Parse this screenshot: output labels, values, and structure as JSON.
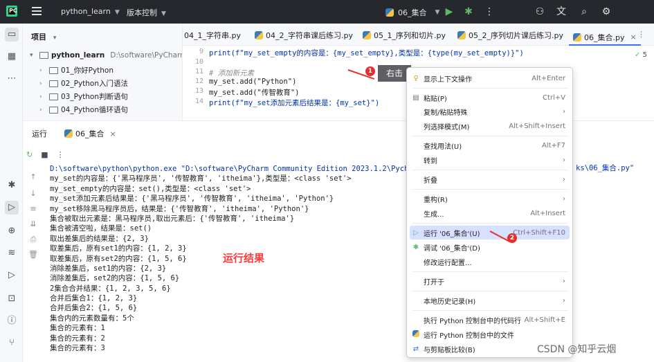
{
  "titlebar": {
    "logo_text": "PC",
    "project_name": "python_learn",
    "vcs_label": "版本控制",
    "run_config": "06_集合",
    "icons": [
      "play-icon",
      "debug-icon",
      "more-icon",
      "add-user-icon",
      "translate-icon",
      "search-icon",
      "settings-icon"
    ]
  },
  "project": {
    "header": "项目",
    "root_name": "python_learn",
    "root_path": "D:\\software\\PyCharm Co",
    "items": [
      "01_你好Python",
      "02_Python入门语法",
      "03_Python判断语句",
      "04_Python循环语句"
    ]
  },
  "tabs": [
    {
      "label": "04_1_字符串.py"
    },
    {
      "label": "04_2_字符串课后练习.py"
    },
    {
      "label": "05_1_序列和切片.py"
    },
    {
      "label": "05_2_序列切片课后练习.py"
    },
    {
      "label": "06_集合.py"
    }
  ],
  "editor": {
    "inspection_count": "5",
    "line_numbers": [
      "9",
      "10",
      "11",
      "12",
      "13",
      "14"
    ],
    "lines": [
      "print(f\"my_set_empty的内容是：{my_set_empty},类型是：{type(my_set_empty)}\")",
      "",
      "# 添加新元素",
      "my_set.add(\"Python\")",
      "my_set.add(\"传智教育\")",
      "print(f\"my_set添加元素后结果是：{my_set}\")"
    ]
  },
  "run_panel": {
    "title": "运行",
    "tab_label": "06_集合",
    "console": [
      "D:\\software\\python\\python.exe \"D:\\software\\PyCharm Community Edition 2023.1.2\\Pych",
      "my_set的内容是：{'黑马程序员', '传智教育', 'itheima'},类型是：<class 'set'>",
      "my_set_empty的内容是：set(),类型是：<class 'set'>",
      "my_set添加元素后结果是：{'黑马程序员', '传智教育', 'itheima', 'Python'}",
      "my_set移除黑马程序员后，结果是：{'传智教育', 'itheima', 'Python'}",
      "集合被取出元素是：黑马程序员,取出元素后：{'传智教育', 'itheima'}",
      "集合被清空啦，结果是：set()",
      "取出差集后的结果是：{2, 3}",
      "取差集后，原有set1的内容：{1, 2, 3}",
      "取差集后，原有set2的内容：{1, 5, 6}",
      "消除差集后，set1的内容：{2, 3}",
      "消除差集后，set2的内容：{1, 5, 6}",
      "2集合合并结果：{1, 2, 3, 5, 6}",
      "合并后集合1：{1, 2, 3}",
      "合并后集合2：{1, 5, 6}",
      "集合内的元素数量有：5个",
      "集合的元素有：1",
      "集合的元素有：2",
      "集合的元素有：3"
    ],
    "console_tail": "ks\\06_集合.py\""
  },
  "annotations": {
    "result_label": "运行结果",
    "right_click_label": "右击",
    "badge1": "1",
    "badge2": "2"
  },
  "context_menu": {
    "items": [
      {
        "label": "显示上下文操作",
        "shortcut": "Alt+Enter",
        "icon": "bulb-icon"
      },
      {
        "label": "粘贴(P)",
        "shortcut": "Ctrl+V",
        "icon": "paste-icon"
      },
      {
        "label": "复制/粘贴特殊",
        "submenu": true
      },
      {
        "label": "列选择模式(M)",
        "shortcut": "Alt+Shift+Insert"
      },
      {
        "label": "查找用法(U)",
        "shortcut": "Alt+F7"
      },
      {
        "label": "转到",
        "submenu": true
      },
      {
        "label": "折叠",
        "submenu": true
      },
      {
        "label": "重构(R)",
        "submenu": true
      },
      {
        "label": "生成...",
        "shortcut": "Alt+Insert"
      },
      {
        "label": "运行 '06_集合'(U)",
        "shortcut": "Ctrl+Shift+F10",
        "icon": "run-icon",
        "highlight": true
      },
      {
        "label": "调试 '06_集合'(D)",
        "icon": "debug-icon"
      },
      {
        "label": "修改运行配置..."
      },
      {
        "label": "打开于",
        "submenu": true
      },
      {
        "label": "本地历史记录(H)",
        "submenu": true
      },
      {
        "label": "执行 Python 控制台中的代码行",
        "shortcut": "Alt+Shift+E"
      },
      {
        "label": "运行 Python 控制台中的文件",
        "icon": "python-icon"
      },
      {
        "label": "与剪贴板比较(B)",
        "icon": "compare-icon"
      }
    ]
  },
  "watermark": "CSDN @知乎云烟"
}
